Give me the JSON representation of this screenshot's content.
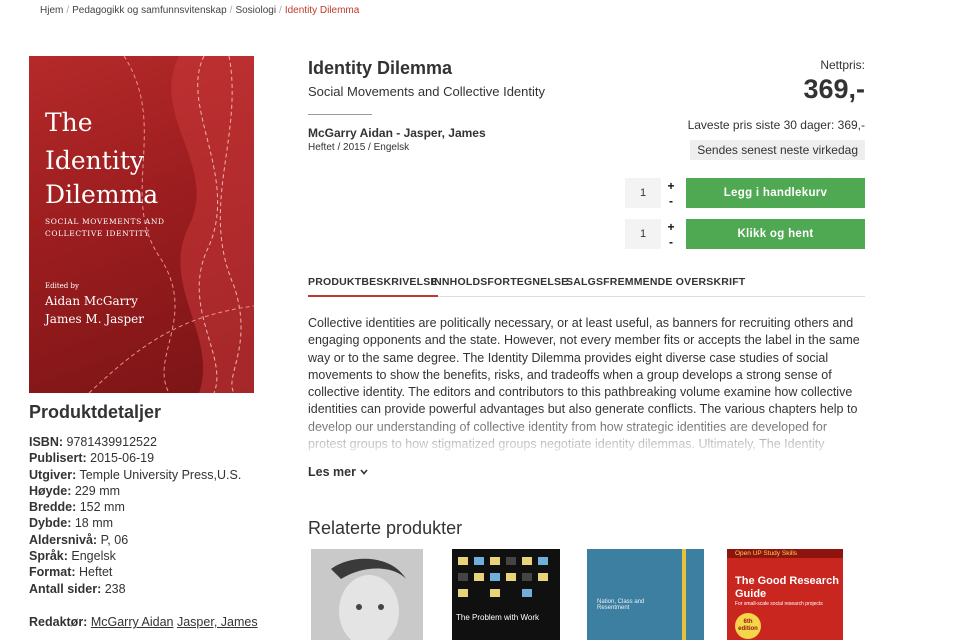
{
  "breadcrumb": {
    "items": [
      "Hjem",
      "Pedagogikk og samfunnsvitenskap",
      "Sosiologi"
    ],
    "current": "Identity Dilemma"
  },
  "cover": {
    "title_lines": [
      "The",
      "Identity",
      "Dilemma"
    ],
    "subtitle": "SOCIAL MOVEMENTS AND COLLECTIVE IDENTITY",
    "edited_by": "Edited by",
    "editors": [
      "Aidan McGarry",
      "James M. Jasper"
    ]
  },
  "product": {
    "title": "Identity Dilemma",
    "subtitle": "Social Movements and Collective Identity",
    "authors": "McGarry Aidan - Jasper, James",
    "meta": "Heftet / 2015 / Engelsk"
  },
  "price": {
    "label": "Nettpris:",
    "value": "369,-",
    "lowest": "Laveste pris siste 30 dager: 369,-",
    "shipping": "Sendes senest neste virkedag"
  },
  "cart": {
    "qty1": "1",
    "qty2": "1",
    "plus": "+",
    "minus": "-",
    "add_to_cart": "Legg i handlekurv",
    "click_collect": "Klikk og hent"
  },
  "tabs": [
    "PRODUKTBESKRIVELSE",
    "INNHOLDSFORTEGNELSE",
    "SALGSFREMMENDE OVERSKRIFT"
  ],
  "description": "Collective identities are politically necessary, or at least useful, as banners for recruiting others and engaging opponents and the state. However, not every member fits or accepts the label in the same way or to the same degree. The Identity Dilemma provides eight diverse case studies of social movements to show the benefits, risks, and tradeoffs when a group develops a strong sense of collective identity.   The editors and contributors to this pathbreaking volume examine how collective identities can provide powerful advantages but also generate conflicts. The various chapters help to develop our understanding of collective identity from how strategic identities are developed for protest groups to how stigmatized groups negotiate identity dilemmas.   Ultimately, The Identity Dilemma contributes a",
  "read_more": "Les mer",
  "details": {
    "title": "Produktdetaljer",
    "rows": [
      {
        "label": "ISBN:",
        "value": "9781439912522"
      },
      {
        "label": "Publisert:",
        "value": "2015-06-19"
      },
      {
        "label": "Utgiver:",
        "value": "Temple University Press,U.S."
      },
      {
        "label": "Høyde:",
        "value": "229 mm"
      },
      {
        "label": "Bredde:",
        "value": "152 mm"
      },
      {
        "label": "Dybde:",
        "value": "18 mm"
      },
      {
        "label": "Aldersnivå:",
        "value": "P, 06"
      },
      {
        "label": "Språk:",
        "value": "Engelsk"
      },
      {
        "label": "Format:",
        "value": "Heftet"
      },
      {
        "label": "Antall sider:",
        "value": "238"
      }
    ],
    "editor_label": "Redaktør:",
    "editor_names": [
      "McGarry Aidan",
      "Jasper, James"
    ]
  },
  "related": {
    "title": "Relaterte produkter",
    "items": [
      {
        "title": ""
      },
      {
        "title": "The Problem with Work"
      },
      {
        "title": "Nation, Class and Resentment"
      },
      {
        "series": "Open UP Study Skills",
        "title": "The Good Research Guide",
        "subtitle": "For small-scale social research projects",
        "badge": "6th edition"
      }
    ]
  },
  "colors": {
    "accent_red": "#c0392b",
    "button_green": "#4fa852"
  }
}
